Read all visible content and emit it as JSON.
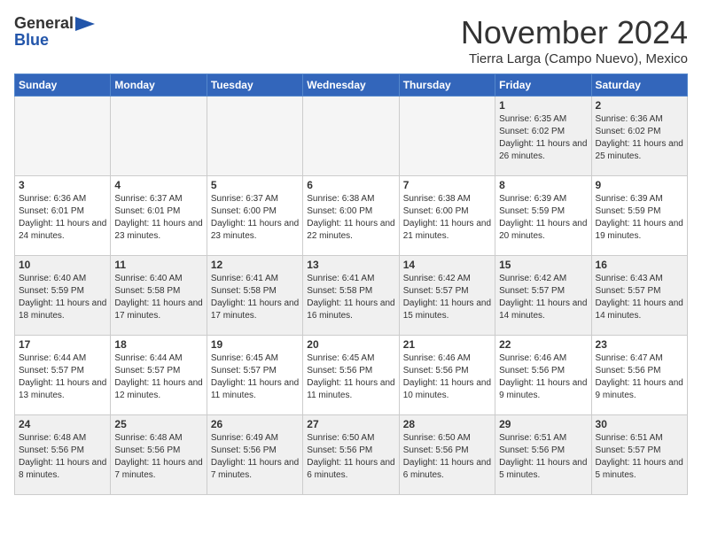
{
  "header": {
    "logo_general": "General",
    "logo_blue": "Blue",
    "month_title": "November 2024",
    "location": "Tierra Larga (Campo Nuevo), Mexico"
  },
  "weekdays": [
    "Sunday",
    "Monday",
    "Tuesday",
    "Wednesday",
    "Thursday",
    "Friday",
    "Saturday"
  ],
  "weeks": [
    [
      {
        "day": "",
        "info": "",
        "empty": true
      },
      {
        "day": "",
        "info": "",
        "empty": true
      },
      {
        "day": "",
        "info": "",
        "empty": true
      },
      {
        "day": "",
        "info": "",
        "empty": true
      },
      {
        "day": "",
        "info": "",
        "empty": true
      },
      {
        "day": "1",
        "info": "Sunrise: 6:35 AM\nSunset: 6:02 PM\nDaylight: 11 hours and 26 minutes.",
        "empty": false
      },
      {
        "day": "2",
        "info": "Sunrise: 6:36 AM\nSunset: 6:02 PM\nDaylight: 11 hours and 25 minutes.",
        "empty": false
      }
    ],
    [
      {
        "day": "3",
        "info": "Sunrise: 6:36 AM\nSunset: 6:01 PM\nDaylight: 11 hours and 24 minutes.",
        "empty": false
      },
      {
        "day": "4",
        "info": "Sunrise: 6:37 AM\nSunset: 6:01 PM\nDaylight: 11 hours and 23 minutes.",
        "empty": false
      },
      {
        "day": "5",
        "info": "Sunrise: 6:37 AM\nSunset: 6:00 PM\nDaylight: 11 hours and 23 minutes.",
        "empty": false
      },
      {
        "day": "6",
        "info": "Sunrise: 6:38 AM\nSunset: 6:00 PM\nDaylight: 11 hours and 22 minutes.",
        "empty": false
      },
      {
        "day": "7",
        "info": "Sunrise: 6:38 AM\nSunset: 6:00 PM\nDaylight: 11 hours and 21 minutes.",
        "empty": false
      },
      {
        "day": "8",
        "info": "Sunrise: 6:39 AM\nSunset: 5:59 PM\nDaylight: 11 hours and 20 minutes.",
        "empty": false
      },
      {
        "day": "9",
        "info": "Sunrise: 6:39 AM\nSunset: 5:59 PM\nDaylight: 11 hours and 19 minutes.",
        "empty": false
      }
    ],
    [
      {
        "day": "10",
        "info": "Sunrise: 6:40 AM\nSunset: 5:59 PM\nDaylight: 11 hours and 18 minutes.",
        "empty": false
      },
      {
        "day": "11",
        "info": "Sunrise: 6:40 AM\nSunset: 5:58 PM\nDaylight: 11 hours and 17 minutes.",
        "empty": false
      },
      {
        "day": "12",
        "info": "Sunrise: 6:41 AM\nSunset: 5:58 PM\nDaylight: 11 hours and 17 minutes.",
        "empty": false
      },
      {
        "day": "13",
        "info": "Sunrise: 6:41 AM\nSunset: 5:58 PM\nDaylight: 11 hours and 16 minutes.",
        "empty": false
      },
      {
        "day": "14",
        "info": "Sunrise: 6:42 AM\nSunset: 5:57 PM\nDaylight: 11 hours and 15 minutes.",
        "empty": false
      },
      {
        "day": "15",
        "info": "Sunrise: 6:42 AM\nSunset: 5:57 PM\nDaylight: 11 hours and 14 minutes.",
        "empty": false
      },
      {
        "day": "16",
        "info": "Sunrise: 6:43 AM\nSunset: 5:57 PM\nDaylight: 11 hours and 14 minutes.",
        "empty": false
      }
    ],
    [
      {
        "day": "17",
        "info": "Sunrise: 6:44 AM\nSunset: 5:57 PM\nDaylight: 11 hours and 13 minutes.",
        "empty": false
      },
      {
        "day": "18",
        "info": "Sunrise: 6:44 AM\nSunset: 5:57 PM\nDaylight: 11 hours and 12 minutes.",
        "empty": false
      },
      {
        "day": "19",
        "info": "Sunrise: 6:45 AM\nSunset: 5:57 PM\nDaylight: 11 hours and 11 minutes.",
        "empty": false
      },
      {
        "day": "20",
        "info": "Sunrise: 6:45 AM\nSunset: 5:56 PM\nDaylight: 11 hours and 11 minutes.",
        "empty": false
      },
      {
        "day": "21",
        "info": "Sunrise: 6:46 AM\nSunset: 5:56 PM\nDaylight: 11 hours and 10 minutes.",
        "empty": false
      },
      {
        "day": "22",
        "info": "Sunrise: 6:46 AM\nSunset: 5:56 PM\nDaylight: 11 hours and 9 minutes.",
        "empty": false
      },
      {
        "day": "23",
        "info": "Sunrise: 6:47 AM\nSunset: 5:56 PM\nDaylight: 11 hours and 9 minutes.",
        "empty": false
      }
    ],
    [
      {
        "day": "24",
        "info": "Sunrise: 6:48 AM\nSunset: 5:56 PM\nDaylight: 11 hours and 8 minutes.",
        "empty": false
      },
      {
        "day": "25",
        "info": "Sunrise: 6:48 AM\nSunset: 5:56 PM\nDaylight: 11 hours and 7 minutes.",
        "empty": false
      },
      {
        "day": "26",
        "info": "Sunrise: 6:49 AM\nSunset: 5:56 PM\nDaylight: 11 hours and 7 minutes.",
        "empty": false
      },
      {
        "day": "27",
        "info": "Sunrise: 6:50 AM\nSunset: 5:56 PM\nDaylight: 11 hours and 6 minutes.",
        "empty": false
      },
      {
        "day": "28",
        "info": "Sunrise: 6:50 AM\nSunset: 5:56 PM\nDaylight: 11 hours and 6 minutes.",
        "empty": false
      },
      {
        "day": "29",
        "info": "Sunrise: 6:51 AM\nSunset: 5:56 PM\nDaylight: 11 hours and 5 minutes.",
        "empty": false
      },
      {
        "day": "30",
        "info": "Sunrise: 6:51 AM\nSunset: 5:57 PM\nDaylight: 11 hours and 5 minutes.",
        "empty": false
      }
    ]
  ]
}
